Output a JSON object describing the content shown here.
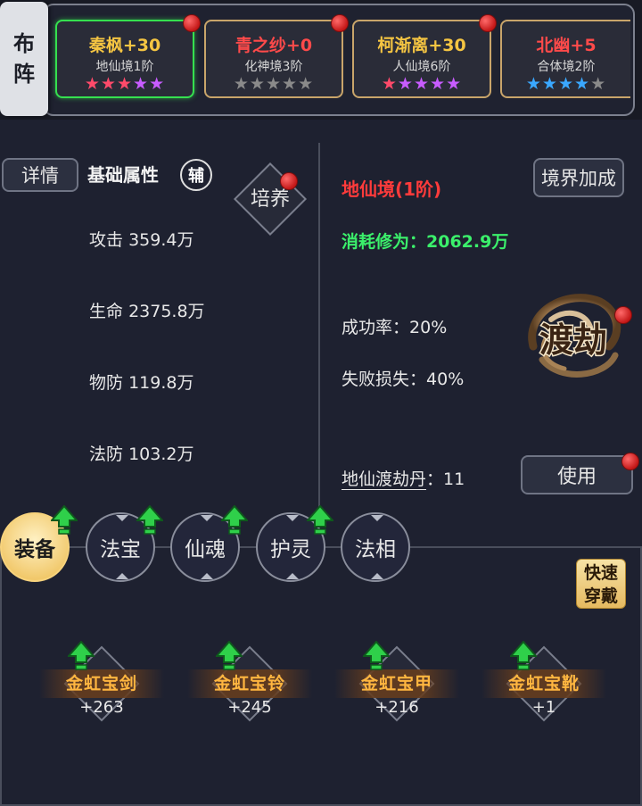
{
  "formation": {
    "label_line1": "布",
    "label_line2": "阵",
    "heroes": [
      {
        "name": "秦枫+30",
        "name_color": "#f5c542",
        "realm": "地仙境1阶",
        "stars": [
          "#ff4a6a",
          "#ff4a6a",
          "#ff4a6a",
          "#c85cff",
          "#c85cff"
        ],
        "selected": true,
        "has_dot": true
      },
      {
        "name": "青之纱+0",
        "name_color": "#ff4a4a",
        "realm": "化神境3阶",
        "stars": [
          "#8a8a8a",
          "#8a8a8a",
          "#8a8a8a",
          "#8a8a8a",
          "#8a8a8a"
        ],
        "selected": false,
        "has_dot": true
      },
      {
        "name": "柯渐离+30",
        "name_color": "#f5c542",
        "realm": "人仙境6阶",
        "stars": [
          "#ff4a6a",
          "#c85cff",
          "#c85cff",
          "#c85cff",
          "#c85cff"
        ],
        "selected": false,
        "has_dot": true
      },
      {
        "name": "北幽+5",
        "name_color": "#ff4a4a",
        "realm": "合体境2阶",
        "stars": [
          "#3aa8ff",
          "#3aa8ff",
          "#3aa8ff",
          "#3aa8ff",
          "#8a8a8a"
        ],
        "selected": false,
        "has_dot": false
      }
    ]
  },
  "left": {
    "details_button": "详情",
    "section_title": "基础属性",
    "role_badge": "辅",
    "cultivate_button": "培养",
    "stats": [
      {
        "label": "攻击",
        "value": "359.4万"
      },
      {
        "label": "生命",
        "value": "2375.8万"
      },
      {
        "label": "物防",
        "value": "119.8万"
      },
      {
        "label": "法防",
        "value": "103.2万"
      }
    ]
  },
  "right": {
    "realm_bonus_button": "境界加成",
    "realm_title": "地仙境(1阶)",
    "cost_label": "消耗修为：",
    "cost_value": "2062.9万",
    "success_rate_label": "成功率：",
    "success_rate_value": "20%",
    "fail_loss_label": "失败损失：",
    "fail_loss_value": "40%",
    "dujie_button": "渡劫",
    "pill_name": "地仙渡劫丹",
    "pill_sep": "：",
    "pill_count": "11",
    "use_button": "使用"
  },
  "tabs": [
    {
      "label": "装备",
      "active": true,
      "has_arrow": true
    },
    {
      "label": "法宝",
      "active": false,
      "has_arrow": true
    },
    {
      "label": "仙魂",
      "active": false,
      "has_arrow": true
    },
    {
      "label": "护灵",
      "active": false,
      "has_arrow": true
    },
    {
      "label": "法相",
      "active": false,
      "has_arrow": false
    }
  ],
  "equipment": {
    "quick_equip_line1": "快速",
    "quick_equip_line2": "穿戴",
    "items": [
      {
        "name": "金虹宝剑",
        "level": "+263"
      },
      {
        "name": "金虹宝铃",
        "level": "+245"
      },
      {
        "name": "金虹宝甲",
        "level": "+216"
      },
      {
        "name": "金虹宝靴",
        "level": "+1"
      }
    ]
  },
  "colors": {
    "background": "#1e2130",
    "selected_border": "#35e04f",
    "card_border": "#c9a56a",
    "realm_red": "#ff3b3b",
    "cost_green": "#3bf06b",
    "equip_gold": "#ffb640",
    "upgrade_green": "#2fd04a"
  }
}
